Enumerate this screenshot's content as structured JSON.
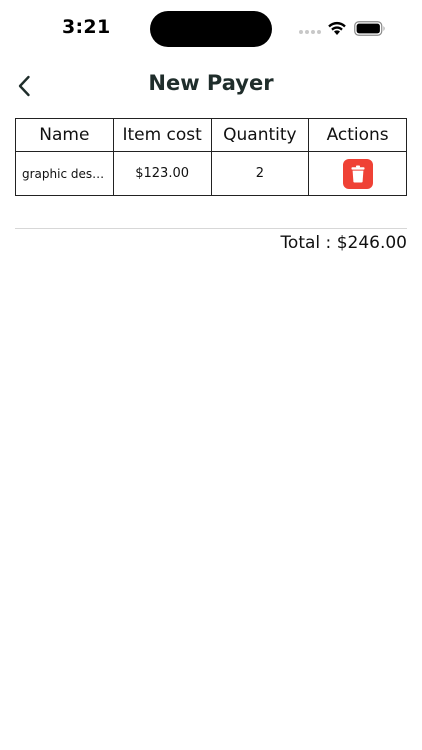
{
  "status_bar": {
    "time": "3:21"
  },
  "header": {
    "title": "New Payer",
    "back_icon": "chevron-left-icon"
  },
  "table": {
    "columns": [
      "Name",
      "Item cost",
      "Quantity",
      "Actions"
    ],
    "rows": [
      {
        "name": "graphic desi...",
        "item_cost": "$123.00",
        "quantity": "2",
        "action_icon": "trash-icon"
      }
    ]
  },
  "summary": {
    "total_label": "Total : ",
    "total_value": "$246.00"
  },
  "colors": {
    "title": "#1f2d2b",
    "delete": "#ef4135",
    "divider": "#d7d7d7"
  }
}
